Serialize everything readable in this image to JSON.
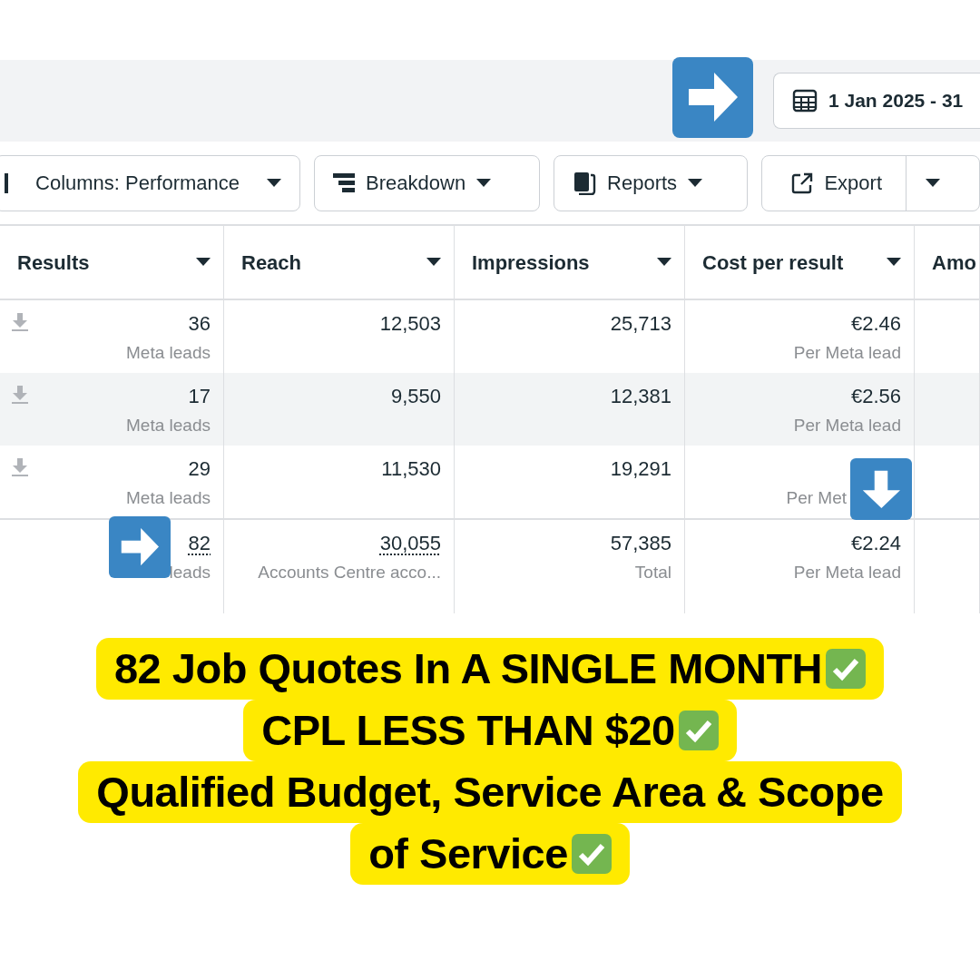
{
  "top_bar": {
    "date_range": "1 Jan 2025 - 31"
  },
  "toolbar": [
    {
      "label": "Columns: Performance",
      "kind": "columns"
    },
    {
      "label": "Breakdown",
      "kind": "breakdown"
    },
    {
      "label": "Reports",
      "kind": "reports"
    },
    {
      "label": "Export",
      "kind": "export"
    }
  ],
  "table": {
    "columns": [
      {
        "label": "Results",
        "sortable": true
      },
      {
        "label": "Reach",
        "sortable": true
      },
      {
        "label": "Impressions",
        "sortable": true
      },
      {
        "label": "Cost per result",
        "sortable": true
      },
      {
        "label": "Amo"
      }
    ],
    "rows": [
      {
        "kind": "row",
        "highlighted": false,
        "cells": [
          {
            "value": "36",
            "sub": "Meta leads"
          },
          {
            "value": "12,503"
          },
          {
            "value": "25,713"
          },
          {
            "value": "€2.46",
            "sub": "Per Meta lead"
          }
        ]
      },
      {
        "kind": "row",
        "highlighted": true,
        "cells": [
          {
            "value": "17",
            "sub": "Meta leads"
          },
          {
            "value": "9,550"
          },
          {
            "value": "12,381"
          },
          {
            "value": "€2.56",
            "sub": "Per Meta lead"
          }
        ]
      },
      {
        "kind": "row",
        "highlighted": false,
        "cells": [
          {
            "value": "29",
            "sub": "Meta leads"
          },
          {
            "value": "11,530"
          },
          {
            "value": "19,291"
          },
          {
            "sub": "Per Met"
          }
        ]
      },
      {
        "kind": "total",
        "highlighted": false,
        "cells": [
          {
            "value": "82",
            "sub": "leads",
            "dotted": true
          },
          {
            "value": "30,055",
            "sub": "Accounts Centre acco...",
            "dotted": true
          },
          {
            "value": "57,385",
            "sub": "Total"
          },
          {
            "value": "€2.24",
            "sub": "Per Meta lead"
          }
        ]
      }
    ]
  },
  "caption": [
    {
      "text": "82 Job Quotes In A SINGLE MONTH",
      "check": true
    },
    {
      "text": "CPL LESS THAN $20",
      "check": true
    },
    {
      "text": "Qualified Budget, Service Area & Scope",
      "check": false
    },
    {
      "text": "of Service",
      "check": true
    }
  ]
}
